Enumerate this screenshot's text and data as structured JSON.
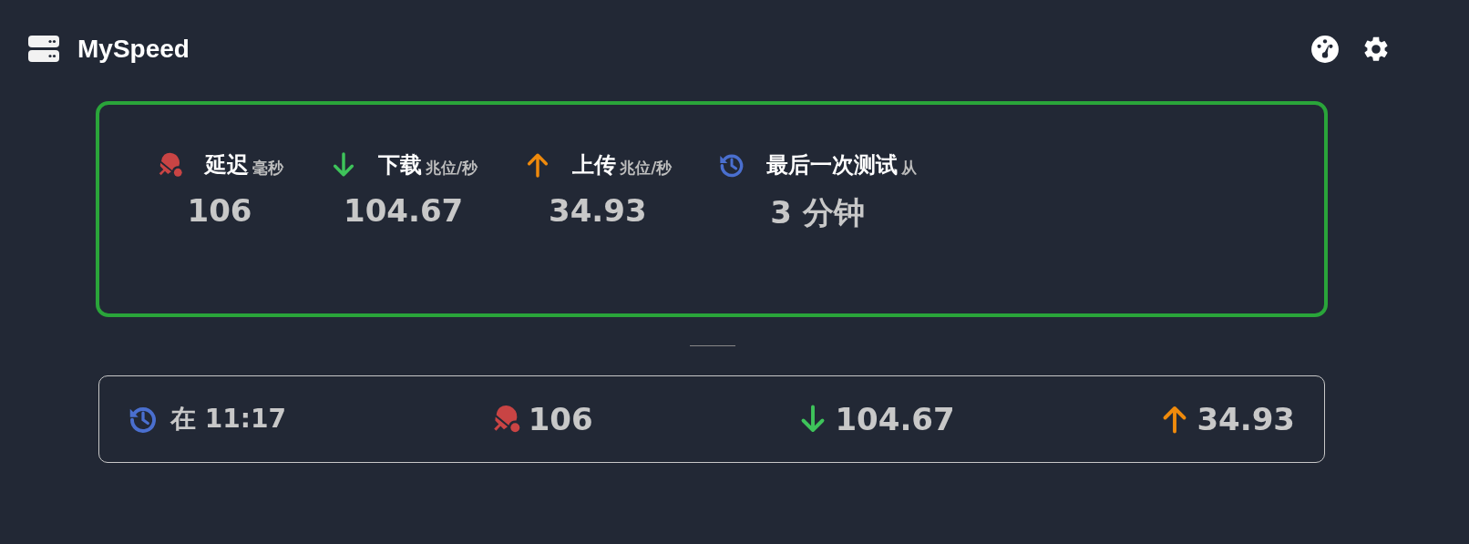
{
  "header": {
    "title": "MySpeed"
  },
  "stats": [
    {
      "kind": "ping",
      "label": "延迟",
      "unit": "毫秒",
      "value": "106"
    },
    {
      "kind": "download",
      "label": "下载",
      "unit": "兆位/秒",
      "value": "104.67"
    },
    {
      "kind": "upload",
      "label": "上传",
      "unit": "兆位/秒",
      "value": "34.93"
    },
    {
      "kind": "time",
      "label": "最后一次测试",
      "unit": "从",
      "value": "3 分钟"
    }
  ],
  "history": [
    {
      "kind": "time",
      "value": "在 11:17"
    },
    {
      "kind": "ping",
      "value": "106"
    },
    {
      "kind": "download",
      "value": "104.67"
    },
    {
      "kind": "upload",
      "value": "34.93"
    }
  ]
}
